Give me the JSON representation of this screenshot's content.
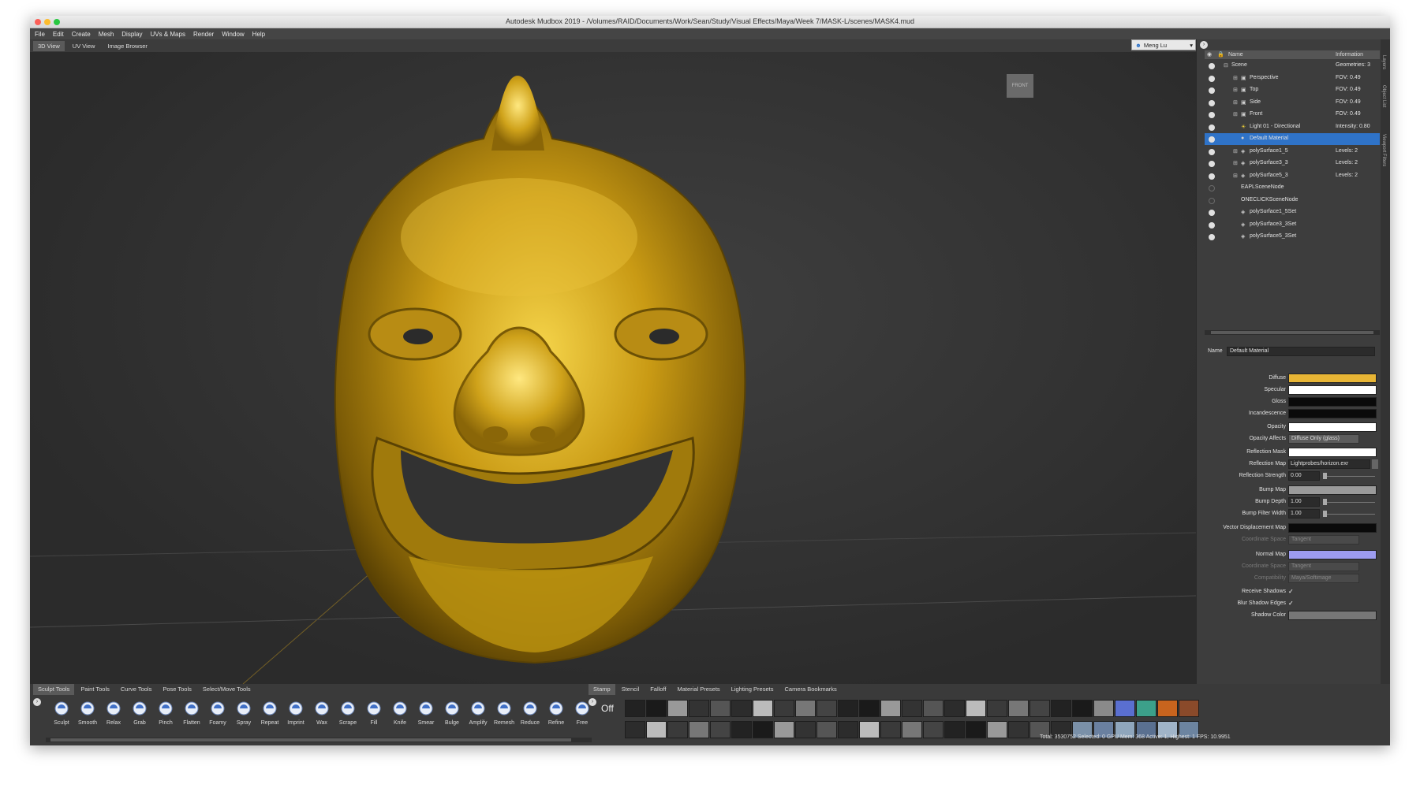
{
  "window": {
    "title": "Autodesk Mudbox 2019 - /Volumes/RAID/Documents/Work/Sean/Study/Visual Effects/Maya/Week 7/MASK-L/scenes/MASK4.mud"
  },
  "menu": [
    "File",
    "Edit",
    "Create",
    "Mesh",
    "Display",
    "UVs & Maps",
    "Render",
    "Window",
    "Help"
  ],
  "view_tabs": [
    "3D View",
    "UV View",
    "Image Browser"
  ],
  "user": "Meng Lu",
  "viewport": {
    "camera_label": "FRONT"
  },
  "side_strip": [
    "Layers",
    "Object List",
    "Viewport Filters"
  ],
  "scene": {
    "header_name": "Name",
    "header_info": "Information",
    "rows": [
      {
        "name": "Scene",
        "info": "Geometries: 3",
        "indent": 0,
        "tw": "⊟"
      },
      {
        "name": "Perspective",
        "info": "FOV: 0.49",
        "indent": 1,
        "tw": "⊞",
        "icon": "camera-icon"
      },
      {
        "name": "Top",
        "info": "FOV: 0.49",
        "indent": 1,
        "tw": "⊞",
        "icon": "camera-icon"
      },
      {
        "name": "Side",
        "info": "FOV: 0.49",
        "indent": 1,
        "tw": "⊞",
        "icon": "camera-icon"
      },
      {
        "name": "Front",
        "info": "FOV: 0.49",
        "indent": 1,
        "tw": "⊞",
        "icon": "camera-icon"
      },
      {
        "name": "Light 01 - Directional",
        "info": "Intensity: 0.80",
        "indent": 1,
        "tw": "",
        "icon": "light-icon"
      },
      {
        "name": "Default Material",
        "info": "",
        "indent": 1,
        "tw": "",
        "icon": "material-icon",
        "selected": true
      },
      {
        "name": "polySurface1_5",
        "info": "Levels: 2",
        "indent": 1,
        "tw": "⊞",
        "icon": "mesh-icon"
      },
      {
        "name": "polySurface3_3",
        "info": "Levels: 2",
        "indent": 1,
        "tw": "⊞",
        "icon": "mesh-icon"
      },
      {
        "name": "polySurface5_3",
        "info": "Levels: 2",
        "indent": 1,
        "tw": "⊞",
        "icon": "mesh-icon"
      },
      {
        "name": "EAPLSceneNode",
        "info": "",
        "indent": 1,
        "tw": "",
        "eye_off": true
      },
      {
        "name": "ONECLICKSceneNode",
        "info": "",
        "indent": 1,
        "tw": "",
        "eye_off": true
      },
      {
        "name": "polySurface1_5Set",
        "info": "",
        "indent": 1,
        "tw": "",
        "icon": "set-icon"
      },
      {
        "name": "polySurface3_3Set",
        "info": "",
        "indent": 1,
        "tw": "",
        "icon": "set-icon"
      },
      {
        "name": "polySurface5_3Set",
        "info": "",
        "indent": 1,
        "tw": "",
        "icon": "set-icon"
      }
    ]
  },
  "properties": {
    "name_label": "Name",
    "name_value": "Default Material",
    "diffuse": {
      "label": "Diffuse",
      "color": "#e8b535"
    },
    "specular": {
      "label": "Specular",
      "color": "#ffffff"
    },
    "gloss": {
      "label": "Gloss",
      "color": "#0a0a0a"
    },
    "incandescence": {
      "label": "Incandescence",
      "color": "#0a0a0a"
    },
    "opacity": {
      "label": "Opacity",
      "color": "#ffffff"
    },
    "opacity_affects": {
      "label": "Opacity Affects",
      "value": "Diffuse Only (glass)"
    },
    "reflection_mask": {
      "label": "Reflection Mask",
      "color": "#ffffff"
    },
    "reflection_map": {
      "label": "Reflection Map",
      "value": "Lightprobes/horizon.exr"
    },
    "reflection_strength": {
      "label": "Reflection Strength",
      "value": "0.00"
    },
    "bump_map": {
      "label": "Bump Map",
      "color": "#9a9a9a"
    },
    "bump_depth": {
      "label": "Bump Depth",
      "value": "1.00"
    },
    "bump_filter_width": {
      "label": "Bump Filter Width",
      "value": "1.00"
    },
    "vector_displacement_map": {
      "label": "Vector Displacement Map",
      "color": "#0a0a0a"
    },
    "coordinate_space_1": {
      "label": "Coordinate Space",
      "value": "Tangent"
    },
    "normal_map": {
      "label": "Normal Map",
      "color": "#9d9cf0"
    },
    "coordinate_space_2": {
      "label": "Coordinate Space",
      "value": "Tangent"
    },
    "compatibility": {
      "label": "Compatibility",
      "value": "Maya/Softimage"
    },
    "receive_shadows": {
      "label": "Receive Shadows",
      "check": "✓"
    },
    "blur_shadow_edges": {
      "label": "Blur Shadow Edges",
      "check": "✓"
    },
    "shadow_color": {
      "label": "Shadow Color",
      "color": "#777777"
    }
  },
  "tool_tabs": [
    "Sculpt Tools",
    "Paint Tools",
    "Curve Tools",
    "Pose Tools",
    "Select/Move Tools"
  ],
  "tools": [
    "Sculpt",
    "Smooth",
    "Relax",
    "Grab",
    "Pinch",
    "Flatten",
    "Foamy",
    "Spray",
    "Repeat",
    "Imprint",
    "Wax",
    "Scrape",
    "Fill",
    "Knife",
    "Smear",
    "Bulge",
    "Amplify",
    "Remesh",
    "Reduce",
    "Refine",
    "Free"
  ],
  "stamp_tabs": [
    "Stamp",
    "Stencil",
    "Falloff",
    "Material Presets",
    "Lighting Presets",
    "Camera Bookmarks"
  ],
  "stamp_off_label": "Off",
  "status_bar": "Total: 3530752  Selected: 0 GPU Mem: 368  Active: 1, Highest: 1  FPS: 10.9951"
}
